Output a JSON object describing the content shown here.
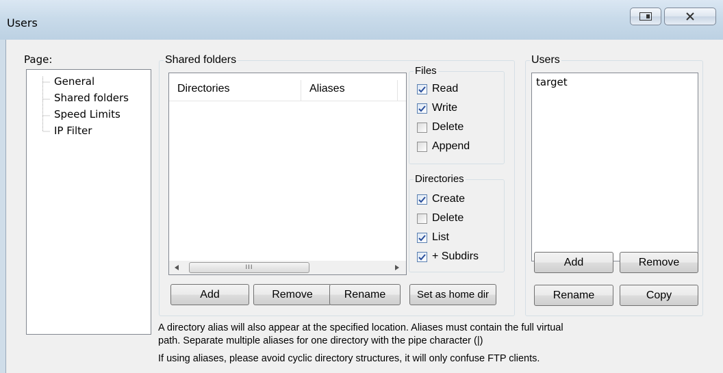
{
  "window": {
    "title": "Users",
    "restore_icon": "restore-window-icon",
    "close_icon": "close-x-icon"
  },
  "page_panel": {
    "label": "Page:",
    "items": [
      "General",
      "Shared folders",
      "Speed Limits",
      "IP Filter"
    ]
  },
  "shared_folders": {
    "title": "Shared folders",
    "columns": [
      "Directories",
      "Aliases"
    ],
    "scroll_thumb_label": "III",
    "buttons": {
      "add": "Add",
      "remove": "Remove",
      "rename": "Rename",
      "set_home": "Set as home dir"
    }
  },
  "files": {
    "title": "Files",
    "options": [
      {
        "label": "Read",
        "checked": true
      },
      {
        "label": "Write",
        "checked": true
      },
      {
        "label": "Delete",
        "checked": false
      },
      {
        "label": "Append",
        "checked": false
      }
    ]
  },
  "directories": {
    "title": "Directories",
    "options": [
      {
        "label": "Create",
        "checked": true
      },
      {
        "label": "Delete",
        "checked": false
      },
      {
        "label": "List",
        "checked": true
      },
      {
        "label": "+ Subdirs",
        "checked": true
      }
    ]
  },
  "users": {
    "title": "Users",
    "list": [
      "target"
    ],
    "buttons": {
      "add": "Add",
      "remove": "Remove",
      "rename": "Rename",
      "copy": "Copy"
    }
  },
  "notes": {
    "line1": "A directory alias will also appear at the specified location. Aliases must contain the full virtual",
    "line2": "path. Separate multiple aliases for one directory with the pipe character (|)",
    "line3": "If using aliases, please avoid cyclic directory structures, it will only confuse FTP clients."
  }
}
